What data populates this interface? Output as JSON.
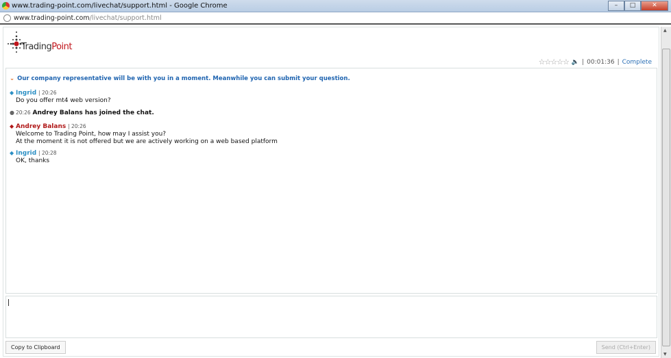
{
  "window": {
    "title": "www.trading-point.com/livechat/support.html - Google Chrome",
    "url_host": "www.trading-point.com",
    "url_path": "/livechat/support.html"
  },
  "logo": {
    "text1": "Trading",
    "text2": "Point"
  },
  "status": {
    "timer": "00:01:36",
    "complete": "Complete",
    "rating": 0
  },
  "notice": "Our company representative will be with you in a moment. Meanwhile you can submit your question.",
  "messages": [
    {
      "name": "Ingrid",
      "time": "20:26",
      "lines": [
        "Do you offer mt4 web version?"
      ]
    },
    {
      "time": "20:26",
      "system": "Andrey Balans has joined the chat."
    },
    {
      "name": "Andrey Balans",
      "time": "20:26",
      "lines": [
        "Welcome to Trading Point, how may I assist you?",
        "At the moment it is not offered but we are actively working on a web based platform"
      ]
    },
    {
      "name": "Ingrid",
      "time": "20:28",
      "lines": [
        "OK, thanks"
      ]
    }
  ],
  "input": {
    "value": ""
  },
  "buttons": {
    "copy": "Copy to Clipboard",
    "send": "Send (Ctrl+Enter)"
  }
}
